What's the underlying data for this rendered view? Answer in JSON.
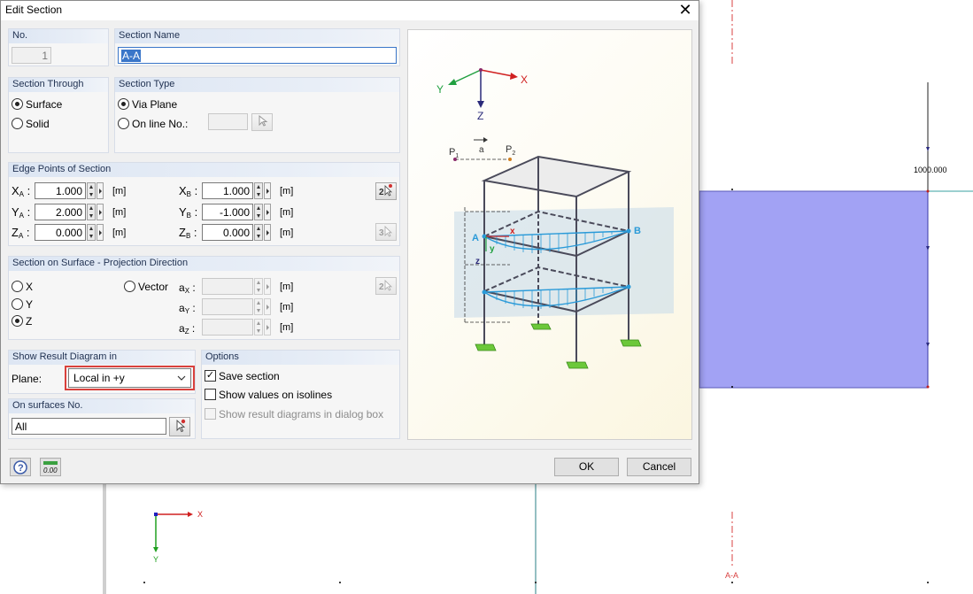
{
  "dialog": {
    "title": "Edit Section",
    "close_glyph": "✕"
  },
  "no": {
    "label": "No.",
    "value": "1"
  },
  "section_name": {
    "label": "Section Name",
    "value": "A-A"
  },
  "section_through": {
    "label": "Section Through",
    "options": [
      "Surface",
      "Solid"
    ],
    "selected": "Surface"
  },
  "section_type": {
    "label": "Section Type",
    "via_plane": "Via Plane",
    "on_line": "On line No.:",
    "on_line_value": "",
    "selected": "Via Plane"
  },
  "edge_points": {
    "label": "Edge Points of Section",
    "rows": [
      {
        "a_label": "X",
        "a_sub": "A",
        "a_value": "1.000",
        "b_label": "X",
        "b_sub": "B",
        "b_value": "1.000"
      },
      {
        "a_label": "Y",
        "a_sub": "A",
        "a_value": "2.000",
        "b_label": "Y",
        "b_sub": "B",
        "b_value": "-1.000"
      },
      {
        "a_label": "Z",
        "a_sub": "A",
        "a_value": "0.000",
        "b_label": "Z",
        "b_sub": "B",
        "b_value": "0.000"
      }
    ],
    "unit": "[m]",
    "pick_2_label": "2",
    "pick_3_label": "3"
  },
  "projection": {
    "label": "Section on Surface - Projection Direction",
    "options": [
      "X",
      "Y",
      "Z"
    ],
    "selected": "Z",
    "vector": "Vector",
    "comp_labels": [
      {
        "main": "a",
        "sub": "X"
      },
      {
        "main": "a",
        "sub": "Y"
      },
      {
        "main": "a",
        "sub": "Z"
      }
    ],
    "unit": "[m]"
  },
  "result_diagram": {
    "label": "Show Result Diagram in",
    "plane_label": "Plane:",
    "plane_value": "Local in +y"
  },
  "surfaces": {
    "label": "On surfaces No.",
    "value": "All"
  },
  "options": {
    "label": "Options",
    "save_section": "Save section",
    "show_values": "Show values on isolines",
    "show_result": "Show result diagrams in dialog box",
    "save_checked": true,
    "values_checked": false,
    "result_checked": false
  },
  "buttons": {
    "ok": "OK",
    "cancel": "Cancel",
    "units_icon_text": "0.00"
  },
  "preview_labels": {
    "x": "X",
    "y": "Y",
    "z": "Z",
    "p1": "P",
    "p1_sub": "1",
    "p2": "P",
    "p2_sub": "2",
    "a": "a",
    "pt_a": "A",
    "pt_b": "B",
    "local_x": "x",
    "local_y": "y",
    "local_z": "z"
  },
  "canvas": {
    "load_value": "1000.000",
    "section_marker": "A-A",
    "axis_x": "X",
    "axis_y": "Y"
  },
  "colors": {
    "surface_fill": "#a2a2f4",
    "highlight": "#d9413c",
    "diagram": "#2a9ad8"
  }
}
